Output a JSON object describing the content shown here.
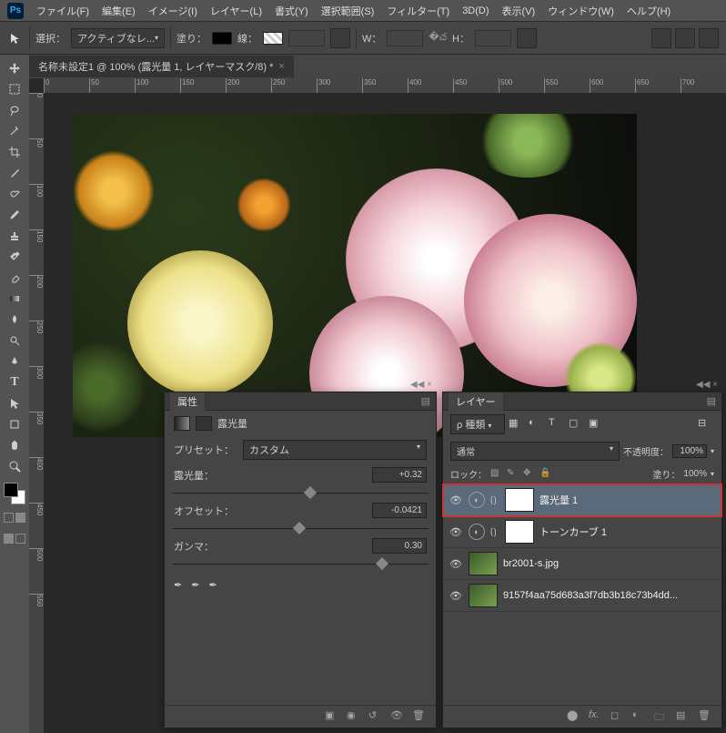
{
  "app": {
    "logo": "Ps"
  },
  "menu": {
    "file": "ファイル(F)",
    "edit": "編集(E)",
    "image": "イメージ(I)",
    "layer": "レイヤー(L)",
    "type": "書式(Y)",
    "select": "選択範囲(S)",
    "filter": "フィルター(T)",
    "d3d": "3D(D)",
    "view": "表示(V)",
    "window": "ウィンドウ(W)",
    "help": "ヘルプ(H)"
  },
  "optbar": {
    "select_label": "選択：",
    "select_value": "アクティブなレ...",
    "fill_label": "塗り：",
    "stroke_label": "線：",
    "w_label": "W：",
    "h_label": "H："
  },
  "tab": {
    "title": "名称未設定1 @ 100% (露光量 1, レイヤーマスク/8) *"
  },
  "ruler_ticks": [
    "0",
    "50",
    "100",
    "150",
    "200",
    "250",
    "300",
    "350",
    "400",
    "450",
    "500",
    "550",
    "600",
    "650",
    "700"
  ],
  "ruler_ticks_v": [
    "0",
    "50",
    "100",
    "150",
    "200",
    "250",
    "300",
    "350",
    "400",
    "450",
    "500",
    "550"
  ],
  "props_panel": {
    "title": "属性",
    "adj_name": "露光量",
    "preset_label": "プリセット：",
    "preset_value": "カスタム",
    "exposure_label": "露光量：",
    "exposure_value": "+0.32",
    "offset_label": "オフセット：",
    "offset_value": "-0.0421",
    "gamma_label": "ガンマ：",
    "gamma_value": "0.30"
  },
  "layers_panel": {
    "title": "レイヤー",
    "filter_kind": "種類",
    "blend_mode": "通常",
    "opacity_label": "不透明度：",
    "opacity_value": "100%",
    "lock_label": "ロック：",
    "fill_label": "塗り：",
    "fill_value": "100%",
    "layers": [
      {
        "name": "露光量 1",
        "type": "adj",
        "selected": true
      },
      {
        "name": "トーンカーブ 1",
        "type": "adj",
        "selected": false
      },
      {
        "name": "br2001-s.jpg",
        "type": "img",
        "selected": false
      },
      {
        "name": "9157f4aa75d683a3f7db3b18c73b4dd...",
        "type": "img",
        "selected": false
      }
    ]
  }
}
